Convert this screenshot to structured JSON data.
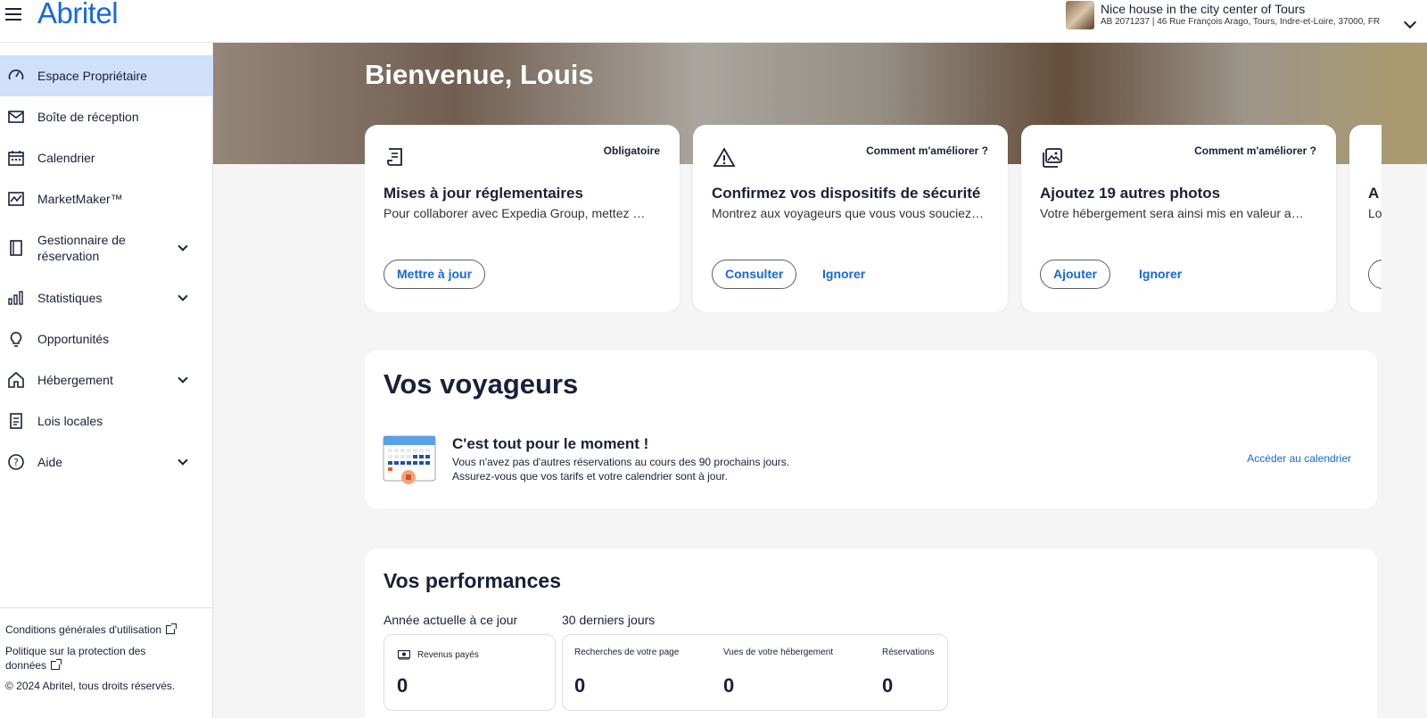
{
  "header": {
    "logo": "Abritel",
    "logo_mark": "®",
    "property_title": "Nice house in the city center of Tours",
    "property_subtitle": "AB 2071237 | 46 Rue François Arago, Tours, Indre-et-Loire, 37000, FR"
  },
  "sidebar": {
    "items": [
      {
        "label": "Espace Propriétaire",
        "icon": "dashboard-gauge-icon",
        "active": true
      },
      {
        "label": "Boîte de réception",
        "icon": "mail-icon"
      },
      {
        "label": "Calendrier",
        "icon": "calendar-icon"
      },
      {
        "label": "MarketMaker™",
        "icon": "trend-chart-icon"
      },
      {
        "label": "Gestionnaire de réservation",
        "icon": "booking-book-icon",
        "expandable": true
      },
      {
        "label": "Statistiques",
        "icon": "bar-chart-icon",
        "expandable": true
      },
      {
        "label": "Opportunités",
        "icon": "lightbulb-icon"
      },
      {
        "label": "Hébergement",
        "icon": "home-icon",
        "expandable": true
      },
      {
        "label": "Lois locales",
        "icon": "document-icon"
      },
      {
        "label": "Aide",
        "icon": "help-icon",
        "expandable": true
      }
    ],
    "footer": {
      "terms": "Conditions générales d'utilisation",
      "privacy": "Politique sur la protection des données",
      "copyright": "© 2024 Abritel, tous droits réservés."
    }
  },
  "main": {
    "welcome": "Bienvenue, Louis",
    "cards": [
      {
        "tag": "Obligatoire",
        "title": "Mises à jour réglementaires",
        "desc": "Pour collaborer avec Expedia Group, mettez …",
        "primary": "Mettre à jour",
        "secondary": ""
      },
      {
        "tag": "Comment m'améliorer ?",
        "title": "Confirmez vos dispositifs de sécurité",
        "desc": "Montrez aux voyageurs que vous vous souciez…",
        "primary": "Consulter",
        "secondary": "Ignorer"
      },
      {
        "tag": "Comment m'améliorer ?",
        "title": "Ajoutez 19 autres photos",
        "desc": "Votre hébergement sera ainsi mis en valeur a…",
        "primary": "Ajouter",
        "secondary": "Ignorer"
      }
    ],
    "card4_partial": {
      "title": "A",
      "desc": "Lo"
    },
    "travelers": {
      "title": "Vos voyageurs",
      "heading": "C'est tout pour le moment !",
      "text": "Vous n'avez pas d'autres réservations au cours des 90 prochains jours. Assurez-vous que vos tarifs et votre calendrier sont à jour.",
      "link": "Accéder au calendrier"
    },
    "performance": {
      "title": "Vos performances",
      "ytd_label": "Année actuelle à ce jour",
      "last30_label": "30 derniers jours",
      "revenue_name": "Revenus payés",
      "revenue_value": "0",
      "searches_name": "Recherches de votre page",
      "searches_value": "0",
      "views_name": "Vues de votre hébergement",
      "views_value": "0",
      "bookings_name": "Réservations",
      "bookings_value": "0"
    }
  },
  "colors": {
    "accent": "#1668e3",
    "active_nav": "#cfe0f8",
    "text": "#1a1f3a"
  }
}
